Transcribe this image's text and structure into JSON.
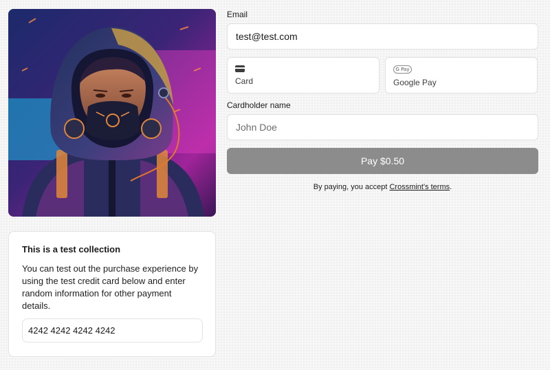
{
  "artwork": {
    "alt": "Cyberpunk character in hood with respirator mask"
  },
  "info": {
    "title": "This is a test collection",
    "body": "You can test out the purchase experience by using the test credit card below and enter random information for other payment details.",
    "card_number": "4242 4242 4242 4242"
  },
  "form": {
    "email_label": "Email",
    "email_value": "test@test.com",
    "methods": [
      {
        "label": "Card",
        "icon": "credit-card-icon"
      },
      {
        "label": "Google Pay",
        "icon": "google-pay-icon",
        "icon_text": "G Pay"
      }
    ],
    "name_label": "Cardholder name",
    "name_placeholder": "John Doe",
    "pay_label": "Pay $0.50",
    "terms_prefix": "By paying, you accept ",
    "terms_link": "Crossmint's terms",
    "terms_suffix": "."
  },
  "colors": {
    "pay_button": "#8c8c8c",
    "border": "#e0e0e0"
  }
}
